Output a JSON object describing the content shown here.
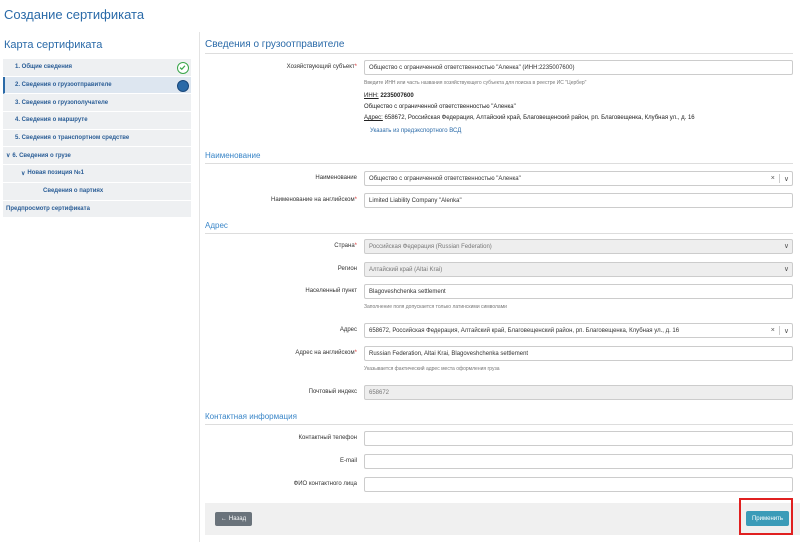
{
  "page": {
    "title": "Создание сертификата"
  },
  "sidebar": {
    "title": "Карта сертификата",
    "items": [
      {
        "label": "1. Общие сведения",
        "status": "done"
      },
      {
        "label": "2. Сведения о грузоотправителе",
        "status": "current"
      },
      {
        "label": "3. Сведения о грузополучателе"
      },
      {
        "label": "4. Сведения о маршруте"
      },
      {
        "label": "5. Сведения о транспортном средстве"
      },
      {
        "label": "6. Сведения о грузе",
        "expanded": true
      },
      {
        "label": "Новая позиция №1",
        "expanded": true
      },
      {
        "label": "Сведения о партиях"
      },
      {
        "label": "Предпросмотр сертификата"
      }
    ]
  },
  "main": {
    "title": "Сведения о грузоотправителе",
    "entity": {
      "label": "Хозяйствующий субъект",
      "value": "Общество с ограниченной ответственностью \"Аленка\" (ИНН:2235007600)",
      "hint": "Введите ИНН или часть названия хозяйствующего субъекта для поиска в реестре ИС \"Цербер\"",
      "inn_label": "ИНН:",
      "inn_value": "2235007600",
      "name": "Общество с ограниченной ответственностью \"Аленка\"",
      "address_label": "Адрес:",
      "address_value": "658672, Российская Федерация, Алтайский край, Благовещенский район, рп. Благовещенка, Клубная ул., д. 16",
      "link": "Указать из предэкспортного ВСД"
    },
    "naming": {
      "title": "Наименование",
      "name_label": "Наименование",
      "name_value": "Общество с ограниченной ответственностью \"Аленка\"",
      "name_en_label": "Наименование на английском",
      "name_en_value": "Limited Liability Company \"Alenka\""
    },
    "address": {
      "title": "Адрес",
      "country_label": "Страна",
      "country_value": "Российская Федерация (Russian Federation)",
      "region_label": "Регион",
      "region_value": "Алтайский край (Altai Krai)",
      "locality_label": "Населенный пункт",
      "locality_value": "Blagoveshchenka settlement",
      "locality_hint": "Заполнение поля допускается только латинскими символами",
      "addr_label": "Адрес",
      "addr_value": "658672, Российская Федерация, Алтайский край, Благовещенский район, рп. Благовещенка, Клубная ул., д. 16",
      "addr_en_label": "Адрес на английском",
      "addr_en_value": "Russian Federation, Altai Krai, Blagoveshchenka settlement",
      "addr_en_hint": "Указывается фактический адрес места оформления груза",
      "postal_label": "Почтовый индекс",
      "postal_value": "658672"
    },
    "contact": {
      "title": "Контактная информация",
      "phone_label": "Контактный телефон",
      "email_label": "E-mail",
      "person_label": "ФИО контактного лица"
    }
  },
  "footer": {
    "back_label": "Назад",
    "apply_label": "Применить"
  },
  "colors": {
    "accent": "#2a6aa8",
    "apply": "#3b9bb8",
    "highlight": "#e02020"
  }
}
